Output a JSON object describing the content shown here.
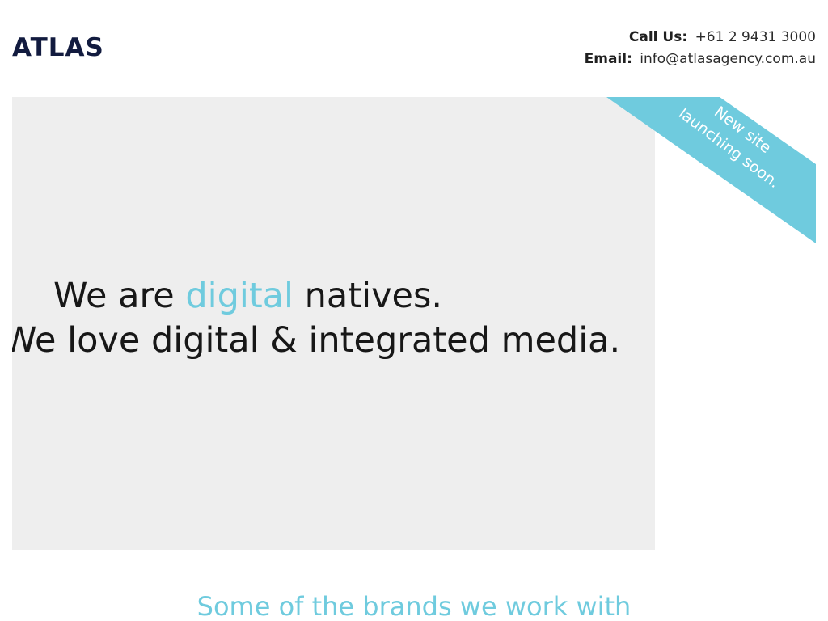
{
  "header": {
    "logo_text": "ATLAS",
    "call_label": "Call Us:",
    "call_value": "+61 2 9431 3000",
    "email_label": "Email:",
    "email_value": "info@atlasagency.com.au"
  },
  "hero": {
    "line1_prefix": "We are ",
    "line1_accent": "digital",
    "line1_suffix": " natives.",
    "line2": "We love digital & integrated media."
  },
  "ribbon": {
    "line1": "New site",
    "line2": "launching soon."
  },
  "section": {
    "title": "Some of the brands we work with"
  },
  "colors": {
    "navy": "#121b3f",
    "accent": "#6fcbde",
    "hero_bg": "#eeeeee",
    "text": "#171717"
  }
}
